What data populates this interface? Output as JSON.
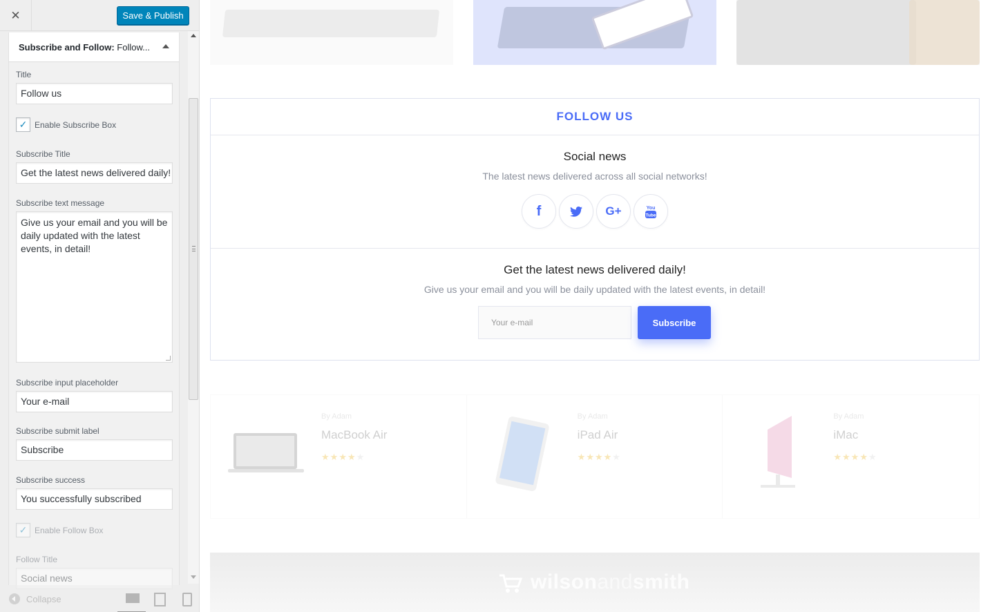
{
  "header": {
    "close_icon": "close-icon",
    "publish_label": "Save & Publish",
    "accent": "#0085ba"
  },
  "section": {
    "title_bold": "Subscribe and Follow:",
    "title_rest": " Follow..."
  },
  "controls": {
    "title_label": "Title",
    "title_value": "Follow us",
    "enable_subscribe_label": "Enable Subscribe Box",
    "enable_subscribe_checked": true,
    "subscribe_title_label": "Subscribe Title",
    "subscribe_title_value": "Get the latest news delivered daily!",
    "subscribe_text_label": "Subscribe text message",
    "subscribe_text_value": "Give us your email and you will be daily updated with the latest events, in detail!",
    "placeholder_label": "Subscribe input placeholder",
    "placeholder_value": "Your e-mail",
    "submit_label_label": "Subscribe submit label",
    "submit_label_value": "Subscribe",
    "success_label": "Subscribe success",
    "success_value": "You successfully subscribed",
    "enable_follow_label": "Enable Follow Box",
    "enable_follow_checked": true,
    "follow_title_label": "Follow Title",
    "follow_title_value": "Social news"
  },
  "footer": {
    "collapse_label": "Collapse",
    "devices": [
      "desktop-icon",
      "tablet-icon",
      "mobile-icon"
    ]
  },
  "preview": {
    "follow_heading": "FOLLOW US",
    "social_title": "Social news",
    "social_subtitle": "The latest news delivered across all social networks!",
    "social_icons": [
      "facebook-icon",
      "twitter-icon",
      "google-plus-icon",
      "youtube-icon"
    ],
    "subscribe_title": "Get the latest news delivered daily!",
    "subscribe_message": "Give us your email and you will be daily updated with the latest events, in detail!",
    "input_placeholder": "Your e-mail",
    "submit_label": "Subscribe",
    "accent": "#4a6cf7",
    "products": [
      {
        "by": "By Adam",
        "name": "MacBook Air",
        "rating": 4,
        "max": 5
      },
      {
        "by": "By Adam",
        "name": "iPad Air",
        "rating": 4,
        "max": 5
      },
      {
        "by": "By Adam",
        "name": "iMac",
        "rating": 4,
        "max": 5
      }
    ],
    "brand_a": "wilson",
    "brand_b": "and",
    "brand_c": "smith"
  }
}
